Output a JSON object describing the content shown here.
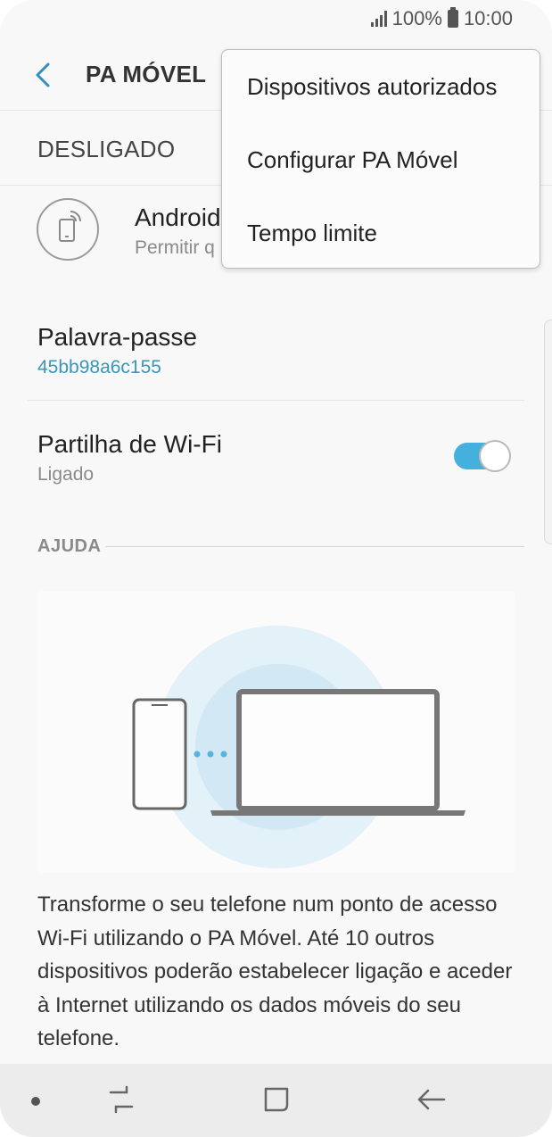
{
  "status_bar": {
    "battery": "100%",
    "time": "10:00"
  },
  "app_bar": {
    "title": "PA MÓVEL"
  },
  "master_switch": {
    "label": "DESLIGADO"
  },
  "device_row": {
    "title": "Android",
    "subtitle": "Permitir q"
  },
  "password_row": {
    "title": "Palavra-passe",
    "value": "45bb98a6c155",
    "value_color": "#3a95b9"
  },
  "wifi_sharing_row": {
    "title": "Partilha de Wi-Fi",
    "subtitle": "Ligado",
    "toggle_on": true,
    "toggle_color": "#45b0de"
  },
  "help": {
    "label": "AJUDA",
    "text": "Transforme o seu telefone num ponto de acesso Wi-Fi utilizando o PA Móvel. Até 10 outros dispositivos poderão estabelecer ligação e aceder à Internet utilizando os dados móveis do seu telefone."
  },
  "overflow_menu": {
    "items": [
      {
        "label": "Dispositivos autorizados"
      },
      {
        "label": "Configurar PA Móvel"
      },
      {
        "label": "Tempo limite"
      }
    ]
  },
  "nav_bar": {
    "icons": [
      "recents-icon",
      "home-icon",
      "back-icon"
    ]
  }
}
